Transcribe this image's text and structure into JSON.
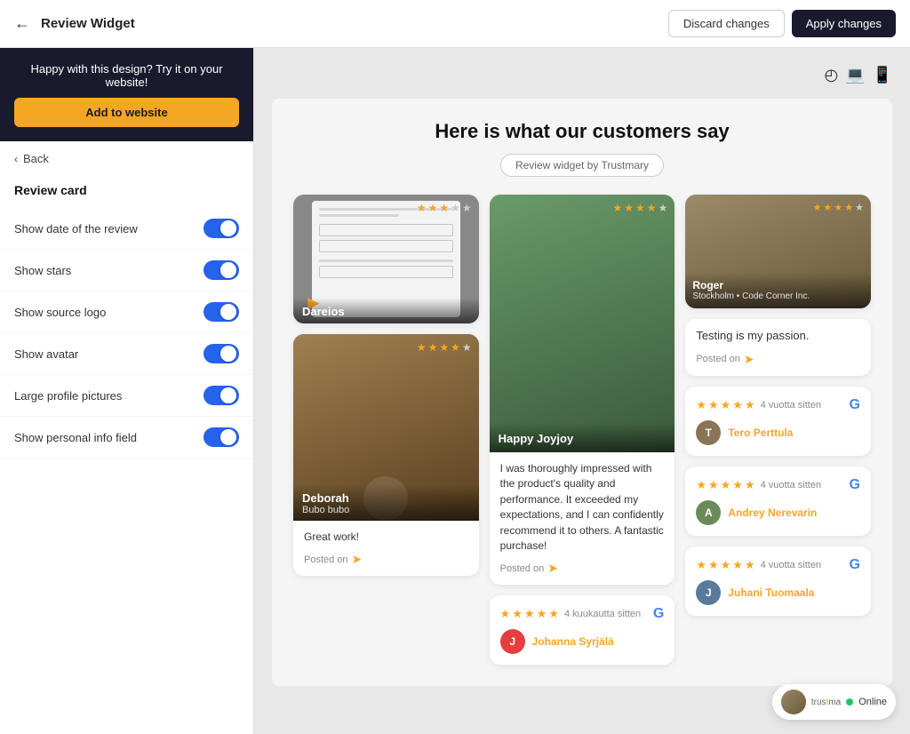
{
  "header": {
    "title": "Review Widget",
    "discard_label": "Discard changes",
    "apply_label": "Apply changes"
  },
  "sidebar": {
    "promo_text": "Happy with this design? Try it on your website!",
    "add_website_label": "Add to website",
    "back_label": "Back",
    "section_title": "Review card",
    "options": [
      {
        "id": "show-date",
        "label": "Show date of the review",
        "enabled": true
      },
      {
        "id": "show-stars",
        "label": "Show stars",
        "enabled": true
      },
      {
        "id": "show-source-logo",
        "label": "Show source logo",
        "enabled": true
      },
      {
        "id": "show-avatar",
        "label": "Show avatar",
        "enabled": true
      },
      {
        "id": "large-profile",
        "label": "Large profile pictures",
        "enabled": true
      },
      {
        "id": "show-personal-info",
        "label": "Show personal info field",
        "enabled": true
      }
    ]
  },
  "widget": {
    "title": "Here is what our customers say",
    "badge": "Review widget by Trustmary",
    "cards": {
      "col1": [
        {
          "type": "video",
          "name": "Dareios",
          "stars": 3,
          "total_stars": 5,
          "image_type": "form"
        },
        {
          "type": "image",
          "name": "Deborah",
          "sub": "Bubo bubo",
          "stars": 4,
          "total_stars": 5,
          "posted_on": true,
          "body_text": "Great work!",
          "image_type": "person"
        }
      ],
      "col2": [
        {
          "type": "image",
          "name": "Happy Joyjoy",
          "stars": 4,
          "total_stars": 5,
          "body_text": "I was thoroughly impressed with the product's quality and performance. It exceeded my expectations, and I can confidently recommend it to others. A fantastic purchase!",
          "posted_on": true,
          "image_type": "person"
        },
        {
          "type": "google",
          "stars": 5,
          "total_stars": 5,
          "time": "4 kuukautta sitten",
          "user_name": "Johanna Syrjälä",
          "avatar_color": "#e53e3e",
          "avatar_letter": "J"
        }
      ],
      "col3": [
        {
          "type": "image",
          "name": "Roger",
          "sub": "Stockholm • Code Corner Inc.",
          "stars": 4,
          "total_stars": 5,
          "image_type": "person"
        },
        {
          "type": "plain",
          "body_text": "Testing is my passion.",
          "posted_on": true
        },
        {
          "type": "google",
          "stars": 5,
          "total_stars": 5,
          "time": "4 vuotta sitten",
          "user_name": "Tero Perttula",
          "avatar_color": "#8b7355",
          "avatar_letter": "T",
          "has_avatar_img": true
        },
        {
          "type": "google",
          "stars": 5,
          "total_stars": 5,
          "time": "4 vuotta sitten",
          "user_name": "Andrey Nerevarin",
          "avatar_color": "#6a8a6a",
          "avatar_letter": "A",
          "has_avatar_img": true
        },
        {
          "type": "google",
          "stars": 5,
          "total_stars": 5,
          "time": "4 vuotta sitten",
          "user_name": "Juhani Tuomaala",
          "avatar_color": "#5a7a9a",
          "avatar_letter": "J",
          "has_avatar_img": true
        }
      ]
    }
  },
  "online_badge": {
    "text": "Online"
  }
}
